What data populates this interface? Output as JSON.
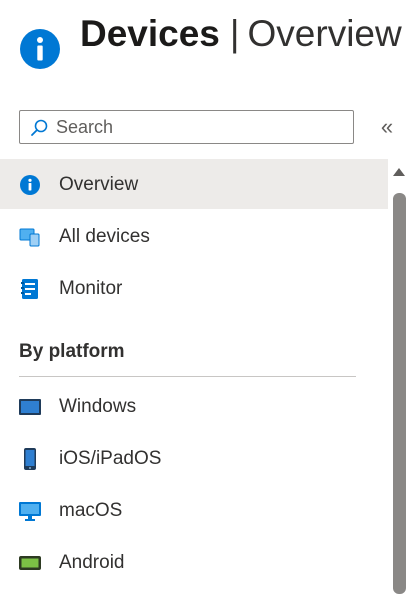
{
  "header": {
    "title": "Devices",
    "separator": "|",
    "subtitle": "Overview",
    "icon": "info-icon",
    "accent": "#0078d4"
  },
  "search": {
    "placeholder": "Search",
    "value": ""
  },
  "collapse_label": "«",
  "nav": {
    "items": [
      {
        "label": "Overview",
        "icon": "info-icon",
        "selected": true
      },
      {
        "label": "All devices",
        "icon": "devices-icon",
        "selected": false
      },
      {
        "label": "Monitor",
        "icon": "monitor-icon",
        "selected": false
      }
    ],
    "sections": [
      {
        "title": "By platform",
        "items": [
          {
            "label": "Windows",
            "icon": "windows-device-icon"
          },
          {
            "label": "iOS/iPadOS",
            "icon": "ios-device-icon"
          },
          {
            "label": "macOS",
            "icon": "macos-device-icon"
          },
          {
            "label": "Android",
            "icon": "android-device-icon"
          }
        ]
      }
    ]
  },
  "colors": {
    "selected_bg": "#edebe9",
    "scrollbar": "#8a8886"
  }
}
